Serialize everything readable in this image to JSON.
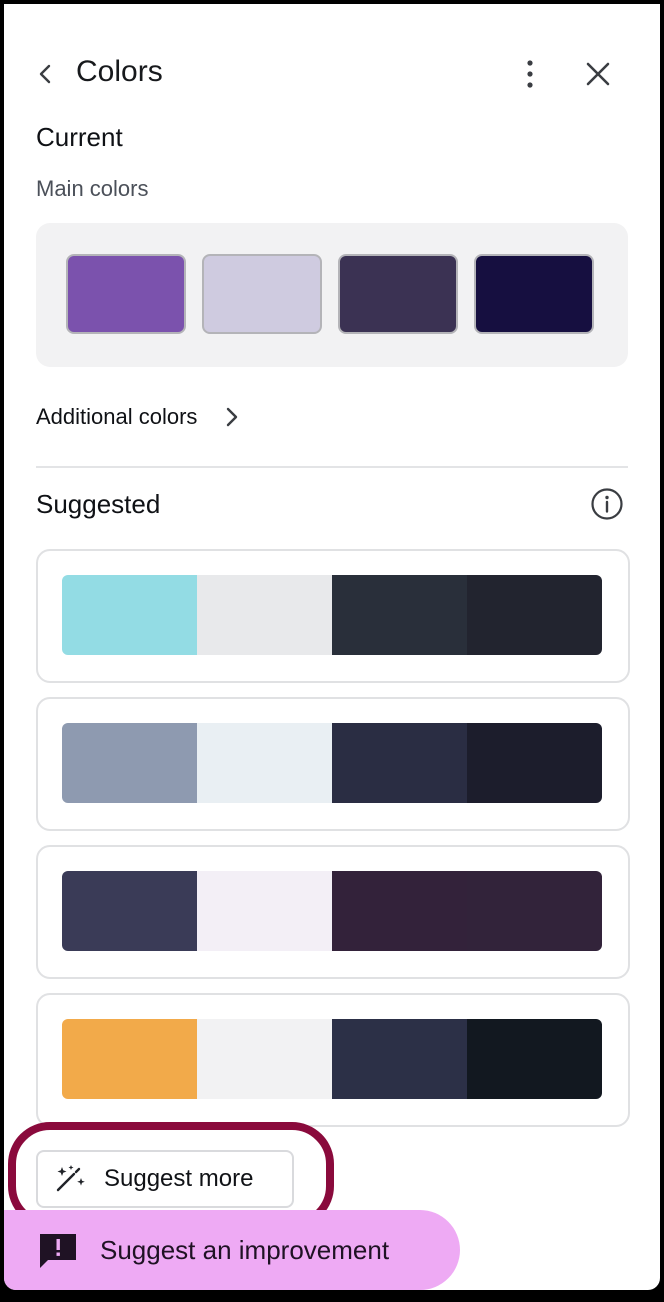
{
  "header": {
    "title": "Colors",
    "back_icon": "chevron-left-icon",
    "more_icon": "more-vertical-icon",
    "close_icon": "close-icon"
  },
  "current": {
    "heading": "Current",
    "main_colors_label": "Main colors",
    "main_colors": [
      "#7b52ad",
      "#cfcbe0",
      "#3b3253",
      "#160f40"
    ],
    "additional_label": "Additional colors"
  },
  "suggested": {
    "heading": "Suggested",
    "info_icon": "info-icon",
    "palettes": [
      [
        "#93dce4",
        "#e8e9eb",
        "#292f3a",
        "#22242f"
      ],
      [
        "#8e9ab0",
        "#e9eff3",
        "#2a2d43",
        "#1c1d2c"
      ],
      [
        "#3a3b57",
        "#f3eff6",
        "#33223a",
        "#32233a"
      ],
      [
        "#f2aa4a",
        "#f2f2f3",
        "#2c3047",
        "#121820"
      ]
    ]
  },
  "actions": {
    "suggest_more_label": "Suggest more",
    "suggest_more_icon": "magic-wand-icon",
    "improvement_label": "Suggest an improvement",
    "improvement_icon": "feedback-icon"
  },
  "colors": {
    "highlight_ring": "#8a0a3c",
    "improvement_bg": "#eeaaf4"
  }
}
